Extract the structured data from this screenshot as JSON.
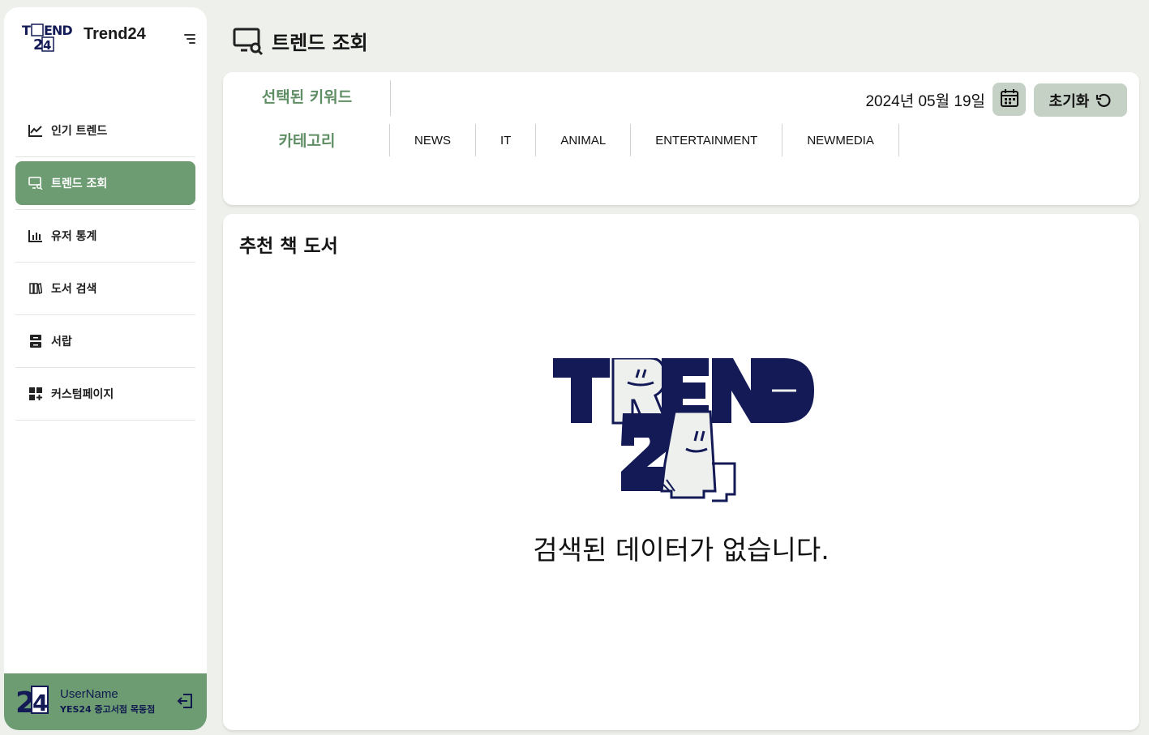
{
  "app": {
    "brand_name": "Trend24",
    "logo_text": "TREND 24"
  },
  "sidebar": {
    "items": [
      {
        "label": "인기 트렌드",
        "icon": "line-chart-icon",
        "active": false
      },
      {
        "label": "트렌드 조회",
        "icon": "monitor-search-icon",
        "active": true
      },
      {
        "label": "유저 통계",
        "icon": "bar-chart-icon",
        "active": false
      },
      {
        "label": "도서 검색",
        "icon": "books-icon",
        "active": false
      },
      {
        "label": "서랍",
        "icon": "drawer-icon",
        "active": false
      },
      {
        "label": "커스텀페이지",
        "icon": "dashboard-add-icon",
        "active": false
      }
    ]
  },
  "profile": {
    "name": "UserName",
    "store": "YES24 중고서점 목동점"
  },
  "header": {
    "title": "트렌드 조회"
  },
  "filter": {
    "keyword_label": "선택된 키워드",
    "category_label": "카테고리",
    "date": "2024년 05월 19일",
    "reset_label": "초기화",
    "categories": [
      "NEWS",
      "IT",
      "ANIMAL",
      "ENTERTAINMENT",
      "NEWMEDIA"
    ]
  },
  "recommendation": {
    "title": "추천 책 도서",
    "empty_message": "검색된 데이터가 없습니다."
  },
  "colors": {
    "accent_green": "#6d9c72",
    "label_green": "#5f8e64",
    "button_gray_green": "#c6d1c5",
    "navy": "#131a55",
    "background": "#eef0ec"
  }
}
